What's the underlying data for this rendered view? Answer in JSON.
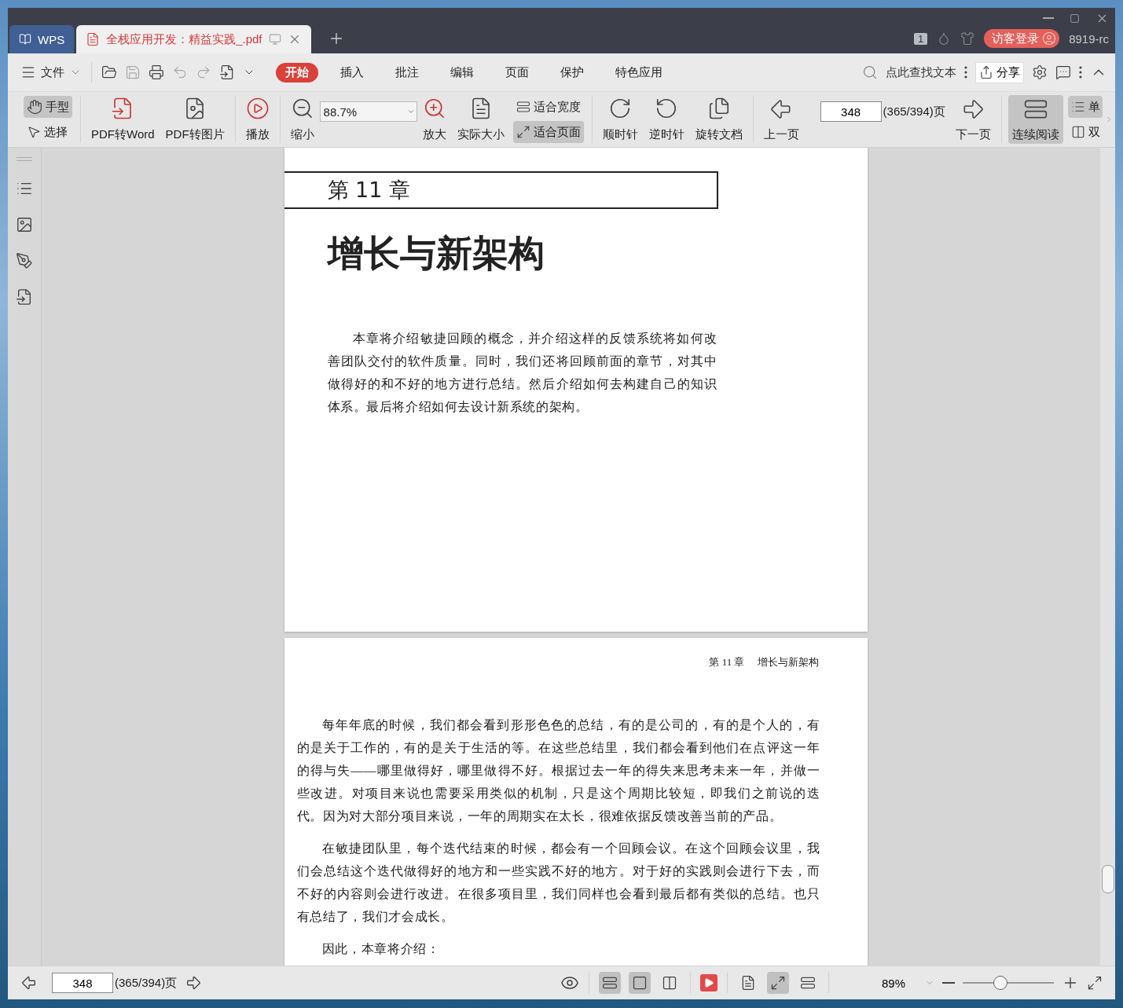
{
  "tabs": [
    {
      "kind": "home",
      "label": "WPS",
      "selected": false
    },
    {
      "kind": "document",
      "label": "全栈应用开发：精益实践_.pdf",
      "selected": true
    }
  ],
  "title_bar": {
    "window_badge": "1",
    "login_button": "访客登录",
    "user": "8919-rc"
  },
  "menu": {
    "file": "文件",
    "tabs": [
      {
        "label": "开始",
        "selected": true
      },
      {
        "label": "插入",
        "selected": false
      },
      {
        "label": "批注",
        "selected": false
      },
      {
        "label": "编辑",
        "selected": false
      },
      {
        "label": "页面",
        "selected": false
      },
      {
        "label": "保护",
        "selected": false
      },
      {
        "label": "特色应用",
        "selected": false
      }
    ],
    "search_placeholder": "点此查找文本",
    "share": "分享"
  },
  "toolbar": {
    "hand": {
      "label": "手型",
      "selected": true
    },
    "select": {
      "label": "选择",
      "selected": false
    },
    "pdf_to_word": "PDF转Word",
    "pdf_to_image": "PDF转图片",
    "play": "播放",
    "zoom_out": "缩小",
    "zoom_value": "88.7%",
    "zoom_in": "放大",
    "actual_size": "实际大小",
    "fit_width": {
      "label": "适合宽度",
      "selected": false
    },
    "fit_page": {
      "label": "适合页面",
      "selected": true
    },
    "clockwise": "顺时针",
    "counterclockwise": "逆时针",
    "rotate_document": "旋转文档",
    "prev_page": "上一页",
    "page_input": "348",
    "page_count": "(365/394)页",
    "next_page": "下一页",
    "continuous": {
      "label": "连续阅读",
      "selected": true
    },
    "single": {
      "label": "单",
      "selected": true
    },
    "double": {
      "label": "双",
      "selected": false
    }
  },
  "document": {
    "page1": {
      "chapter": "第 11 章",
      "title": "增长与新架构",
      "paragraphs": [
        "本章将介绍敏捷回顾的概念，并介绍这样的反馈系统将如何改善团队交付的软件质量。同时，我们还将回顾前面的章节，对其中做得好的和不好的地方进行总结。然后介绍如何去构建自己的知识体系。最后将介绍如何去设计新系统的架构。"
      ]
    },
    "page2": {
      "header_chapter": "第 11 章",
      "header_title": "增长与新架构",
      "paragraphs": [
        "每年年底的时候，我们都会看到形形色色的总结，有的是公司的，有的是个人的，有的是关于工作的，有的是关于生活的等。在这些总结里，我们都会看到他们在点评这一年的得与失——哪里做得好，哪里做得不好。根据过去一年的得失来思考未来一年，并做一些改进。对项目来说也需要采用类似的机制，只是这个周期比较短，即我们之前说的迭代。因为对大部分项目来说，一年的周期实在太长，很难依据反馈改善当前的产品。",
        "在敏捷团队里，每个迭代结束的时候，都会有一个回顾会议。在这个回顾会议里，我们会总结这个迭代做得好的地方和一些实践不好的地方。对于好的实践则会进行下去，而不好的内容则会进行改进。在很多项目里，我们同样也会看到最后都有类似的总结。也只有总结了，我们才会成长。",
        "因此，本章将介绍："
      ]
    }
  },
  "status_bar": {
    "page_input": "348",
    "page_count": "(365/394)页",
    "view_modes": [
      {
        "selected": true
      },
      {
        "selected": true
      },
      {
        "selected": false
      }
    ],
    "fit_modes": [
      {
        "selected": false
      },
      {
        "selected": true
      },
      {
        "selected": false
      }
    ],
    "zoom": "89%",
    "zoom_slider": {
      "level": 0.41
    }
  }
}
